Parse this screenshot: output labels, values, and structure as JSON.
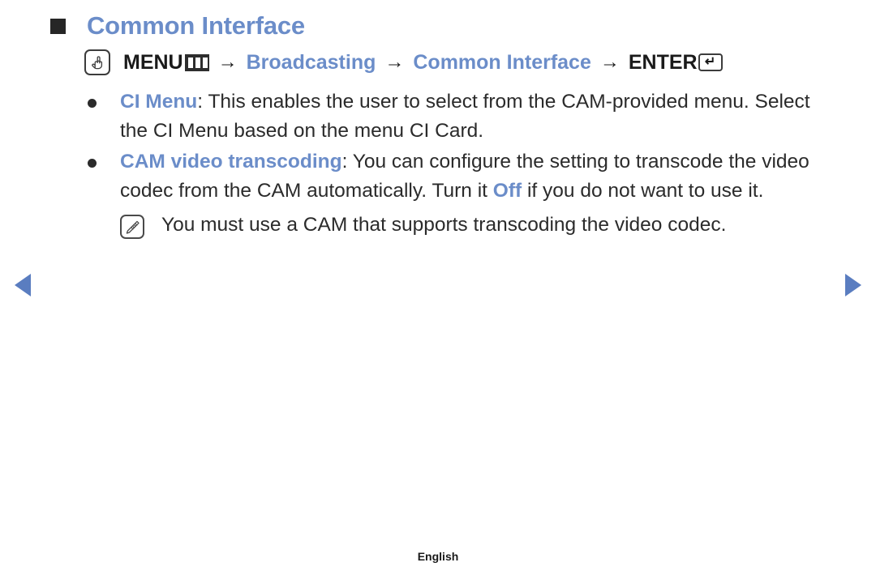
{
  "page": {
    "heading": "Common Interface",
    "heading_bullet_icon": "filled-square-icon",
    "accent_color": "#6b8dc9",
    "text_color": "#2b2b2b"
  },
  "menu_path": {
    "remote_icon": "hand-press-icon",
    "menu_label": "MENU",
    "menu_icon": "menu-bars-icon",
    "separator": "→",
    "step_broadcasting": "Broadcasting",
    "step_common_interface": "Common Interface",
    "enter_label": "ENTER",
    "enter_icon": "return-arrow-icon",
    "enter_glyph": "↵"
  },
  "bullets": [
    {
      "icon": "bullet-dot-icon",
      "term": "CI Menu",
      "separator": ": ",
      "text": "This enables the user to select from the CAM-provided menu. Select the CI Menu based on the menu CI Card."
    },
    {
      "icon": "bullet-dot-icon",
      "term": "CAM video transcoding",
      "separator": ": ",
      "text_part1": "You can configure the setting to transcode the video codec from the CAM automatically. Turn it ",
      "emphasis": "Off",
      "text_part2": " if you do not want to use it."
    }
  ],
  "note": {
    "icon": "note-pencil-icon",
    "text": "You must use a CAM that supports transcoding the video codec."
  },
  "navigation": {
    "prev_icon": "triangle-left-icon",
    "next_icon": "triangle-right-icon",
    "arrow_color": "#5a7dc0"
  },
  "footer": {
    "language": "English"
  }
}
